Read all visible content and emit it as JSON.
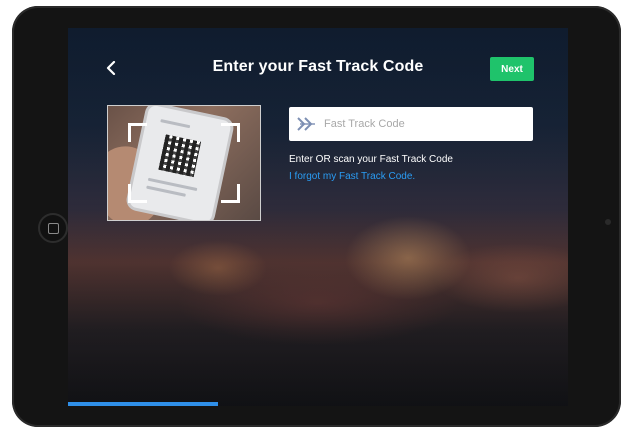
{
  "header": {
    "title": "Enter your Fast Track Code",
    "next_label": "Next"
  },
  "code_input": {
    "placeholder": "Fast Track Code",
    "value": ""
  },
  "helper_text": "Enter OR scan your Fast Track Code",
  "forgot_link": "I forgot my Fast Track Code.",
  "progress": {
    "fraction": 0.3
  },
  "colors": {
    "accent_green": "#1fc36b",
    "link_blue": "#2a9df4",
    "progress_blue": "#2f8fe8"
  },
  "icons": {
    "back": "chevron-left-icon",
    "field": "double-arrow-right-icon",
    "scan": "qr-scan-frame-icon"
  }
}
